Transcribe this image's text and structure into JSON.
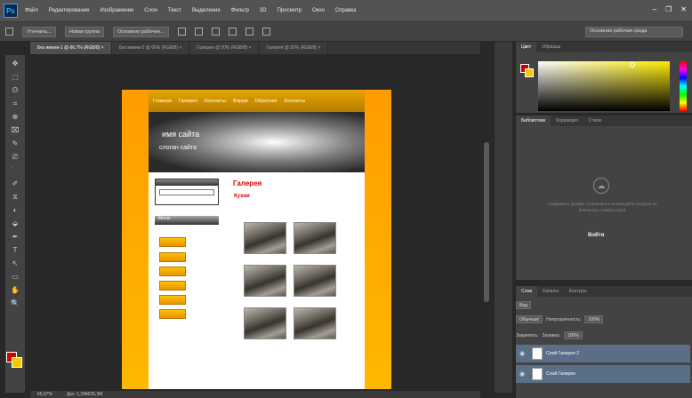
{
  "app": {
    "logo": "Ps",
    "menu": [
      "Файл",
      "Редактирование",
      "Изображение",
      "Слои",
      "Текст",
      "Выделение",
      "Фильтр",
      "3D",
      "Просмотр",
      "Окно",
      "Справка"
    ],
    "window_controls": [
      "–",
      "❐",
      "✕"
    ]
  },
  "options_bar": {
    "buttons": [
      "Уточнить...",
      "Новая группа",
      "Основное рабочее..."
    ],
    "right_dropdown": "Основная рабочая среда"
  },
  "tabs": [
    {
      "label": "Без имени-1 @ 66,7% (RGB/8) ×",
      "active": true
    },
    {
      "label": "Без имени-2 @ 66% (RGB/8) ×",
      "active": false
    },
    {
      "label": "Галерея @ 50% (RGB/8) ×",
      "active": false
    },
    {
      "label": "Галерея @ 50% (RGB/8) ×",
      "active": false
    }
  ],
  "tools": [
    "✥",
    "⬚",
    "ʘ",
    "⌗",
    "⊕",
    "⌧",
    "✎",
    "⎚",
    "⬛",
    "✐",
    "⧖",
    "◐",
    "⬙",
    "✒",
    "T",
    "↖",
    "▭",
    "✋",
    "🔍"
  ],
  "document": {
    "nav": [
      "Главная",
      "Галерея",
      "Контакты",
      "Форум",
      "Обратная",
      "Контакты"
    ],
    "hero_title": "имя сайта",
    "hero_sub": "слоган сайта",
    "menu_head": "Меню",
    "gallery_title": "Галерея",
    "gallery_sub": "Кухни"
  },
  "colors": {
    "foreground": "#d40000",
    "background": "#f6c900",
    "accent_orange": "#ffb000"
  },
  "panels": {
    "color_tabs": [
      "Цвет",
      "Образцы"
    ],
    "lib_tabs": [
      "Библиотеки",
      "Коррекция",
      "Стили"
    ],
    "lib_empty_text": "Создавайте дизайн, сохраняйте и используйте ресурсы из библиотек Creative Cloud",
    "lib_button": "Войти",
    "layer_tabs": [
      "Слои",
      "Каналы",
      "Контуры"
    ],
    "kind_label": "Вид",
    "blend_mode": "Обычные",
    "opacity_label": "Непрозрачность:",
    "opacity_value": "100%",
    "lock_label": "Закрепить:",
    "fill_label": "Заливка:",
    "fill_value": "100%",
    "layers": [
      "Слой Галерея 2",
      "Слой Галерея"
    ]
  },
  "status": {
    "zoom": "66,67%",
    "doc_size": "Док: 1,29М/26,3М"
  }
}
